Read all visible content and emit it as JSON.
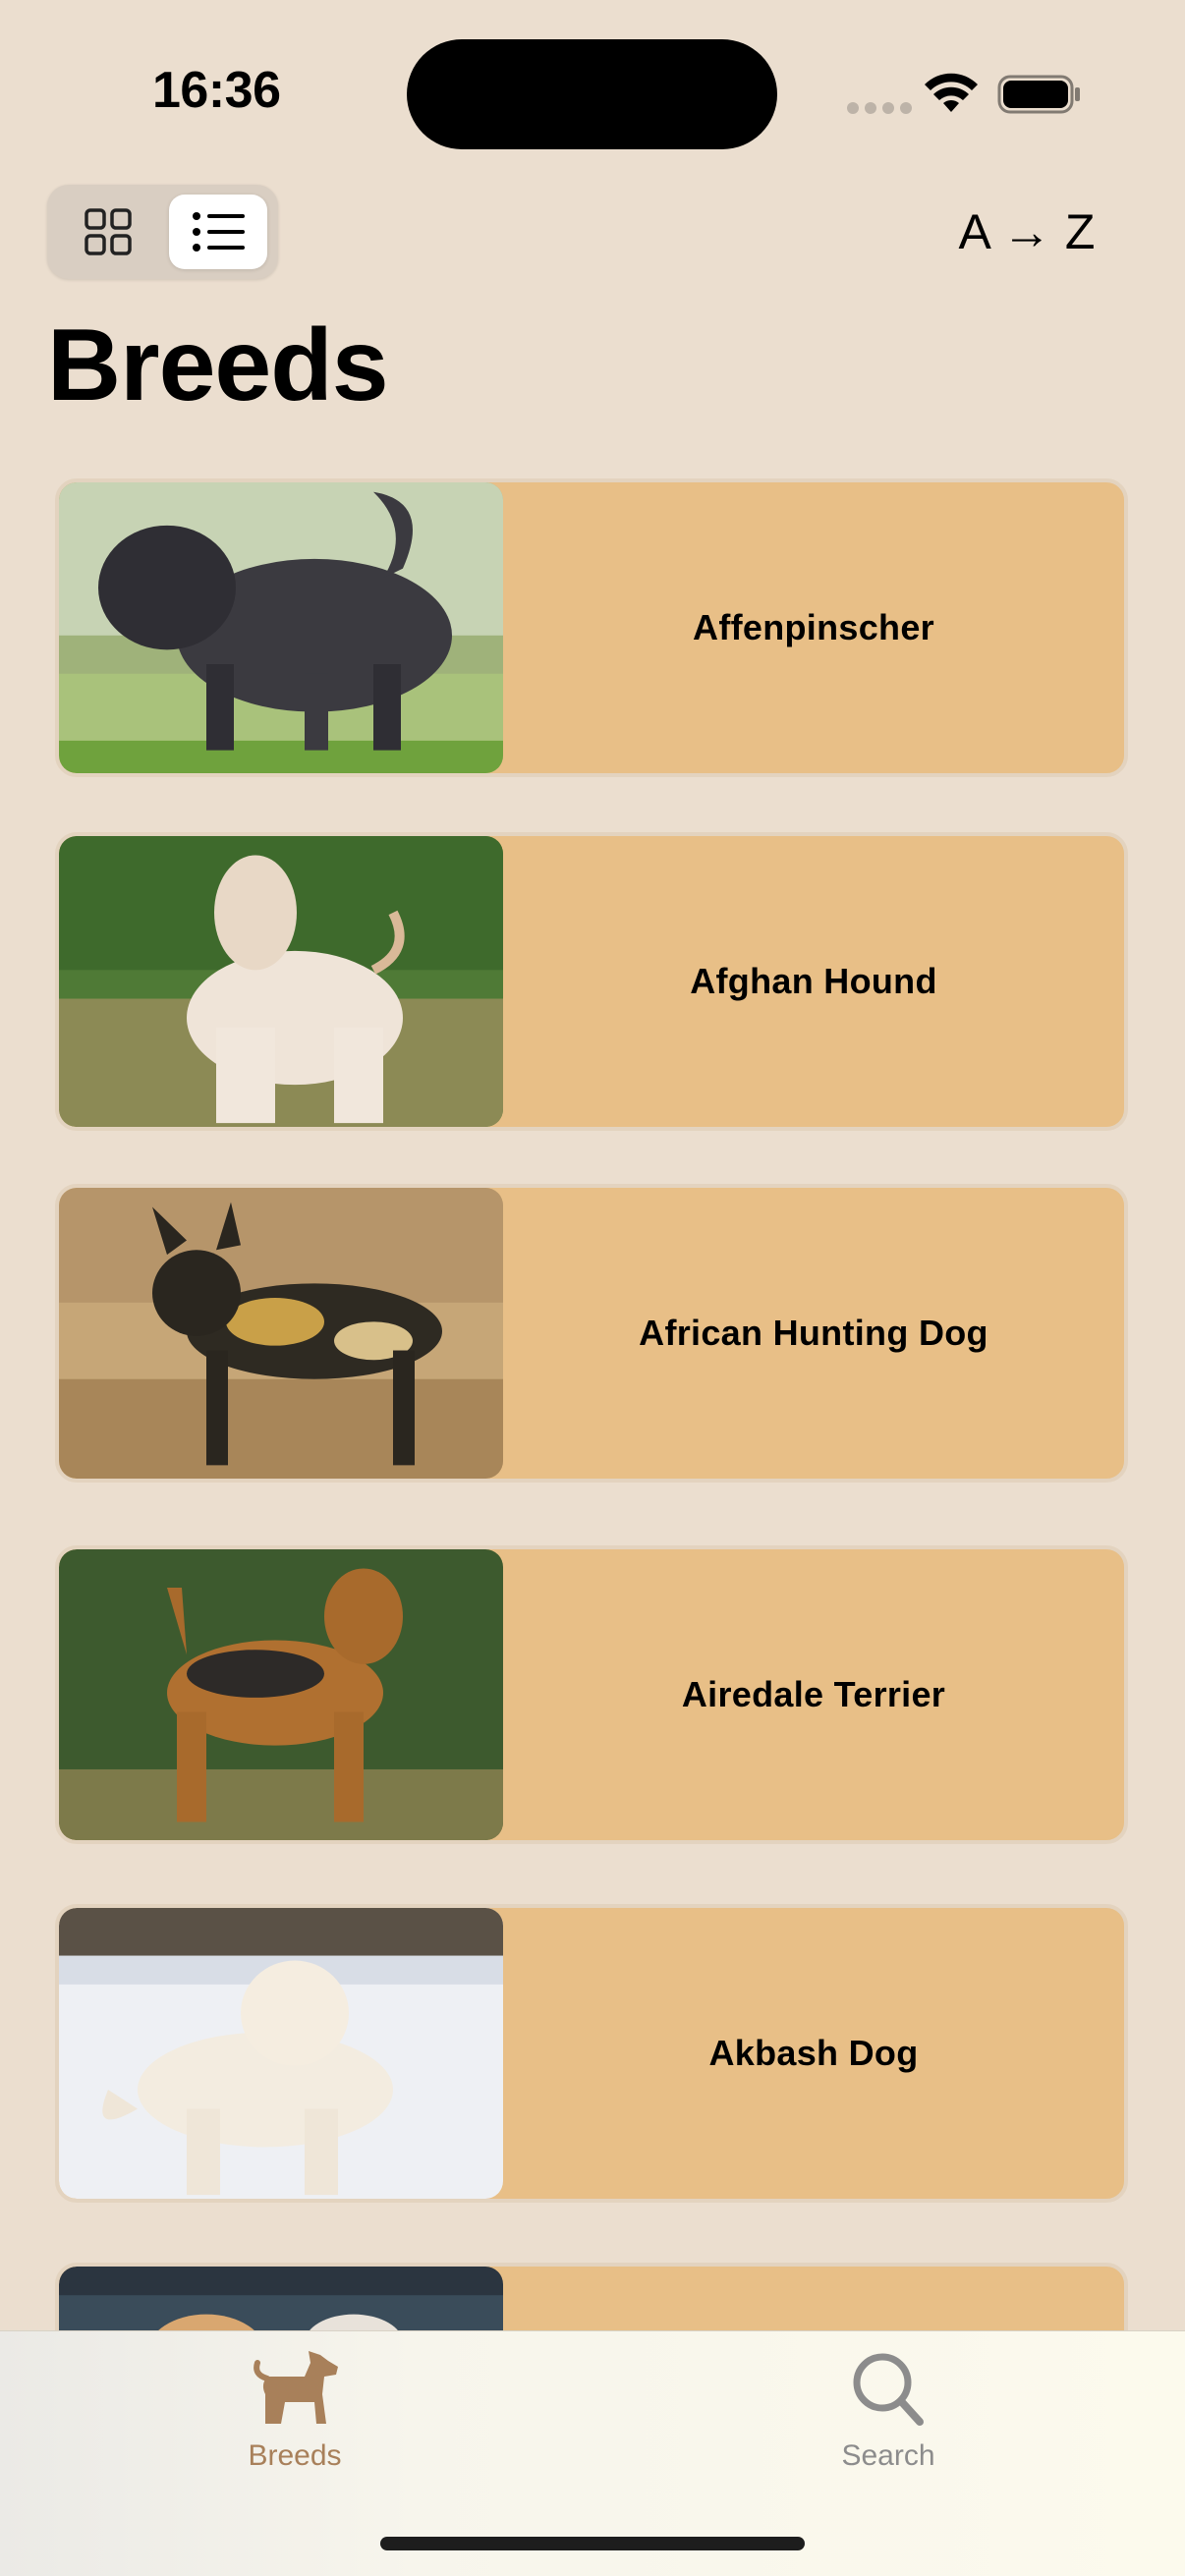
{
  "status_bar": {
    "time": "16:36"
  },
  "toolbar": {
    "grid_view_icon": "grid-icon",
    "list_view_icon": "list-icon",
    "selected_view": "list",
    "sort_label": "A → Z"
  },
  "page": {
    "title": "Breeds"
  },
  "breeds": [
    {
      "name": "Affenpinscher"
    },
    {
      "name": "Afghan Hound"
    },
    {
      "name": "African Hunting Dog"
    },
    {
      "name": "Airedale Terrier"
    },
    {
      "name": "Akbash Dog"
    },
    {
      "name": ""
    }
  ],
  "tab_bar": {
    "tabs": [
      {
        "label": "Breeds",
        "icon": "dog-icon",
        "selected": true
      },
      {
        "label": "Search",
        "icon": "search-icon",
        "selected": false
      }
    ]
  },
  "colors": {
    "background": "#ebdecf",
    "card": "#e8bf87",
    "tab_selected": "#a8805a",
    "tab_unselected": "#8c8c8c"
  }
}
